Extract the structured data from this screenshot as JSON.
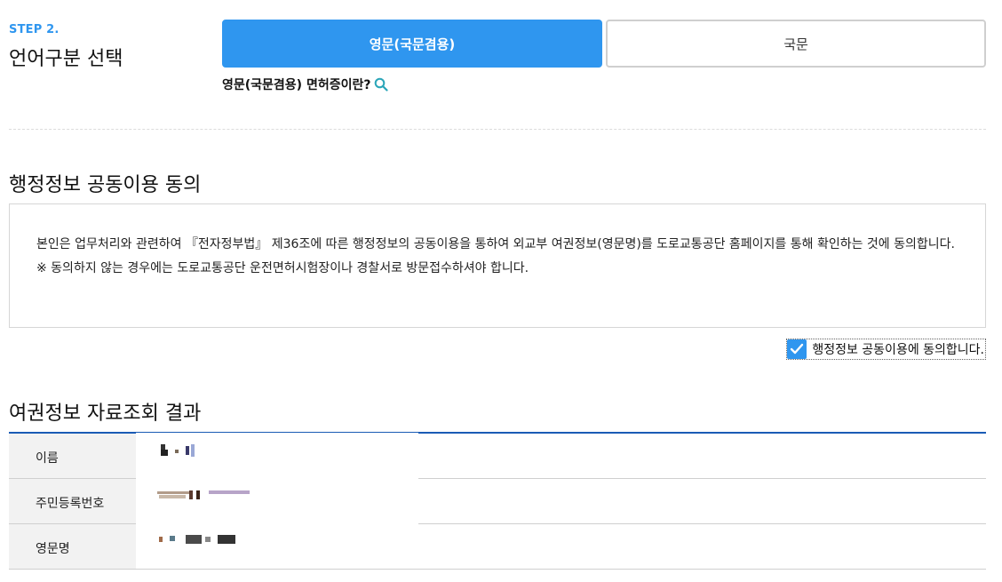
{
  "step": {
    "label": "STEP 2.",
    "title": "언어구분 선택"
  },
  "language_options": {
    "primary": "영문(국문겸용)",
    "secondary": "국문"
  },
  "help_link": {
    "text": "영문(국문겸용) 면허증이란?",
    "icon": "search-icon"
  },
  "consent": {
    "title": "행정정보 공동이용 동의",
    "paragraph_1": "본인은 업무처리와 관련하여 『전자정부법』 제36조에 따른 행정정보의 공동이용을 통하여 외교부 여권정보(영문명)를 도로교통공단 홈페이지를 통해 확인하는 것에 동의합니다.",
    "paragraph_2": "※ 동의하지 않는 경우에는 도로교통공단 운전면허시험장이나 경찰서로 방문접수하셔야 합니다.",
    "checkbox_label": "행정정보 공동이용에 동의합니다.",
    "checked": true
  },
  "result": {
    "title": "여권정보 자료조회 결과",
    "rows": [
      {
        "label": "이름"
      },
      {
        "label": "주민등록번호"
      },
      {
        "label": "영문명"
      }
    ]
  },
  "colors": {
    "accent": "#2f96ef",
    "table_border": "#1a5bb5",
    "header_bg": "#f2f2f2"
  }
}
